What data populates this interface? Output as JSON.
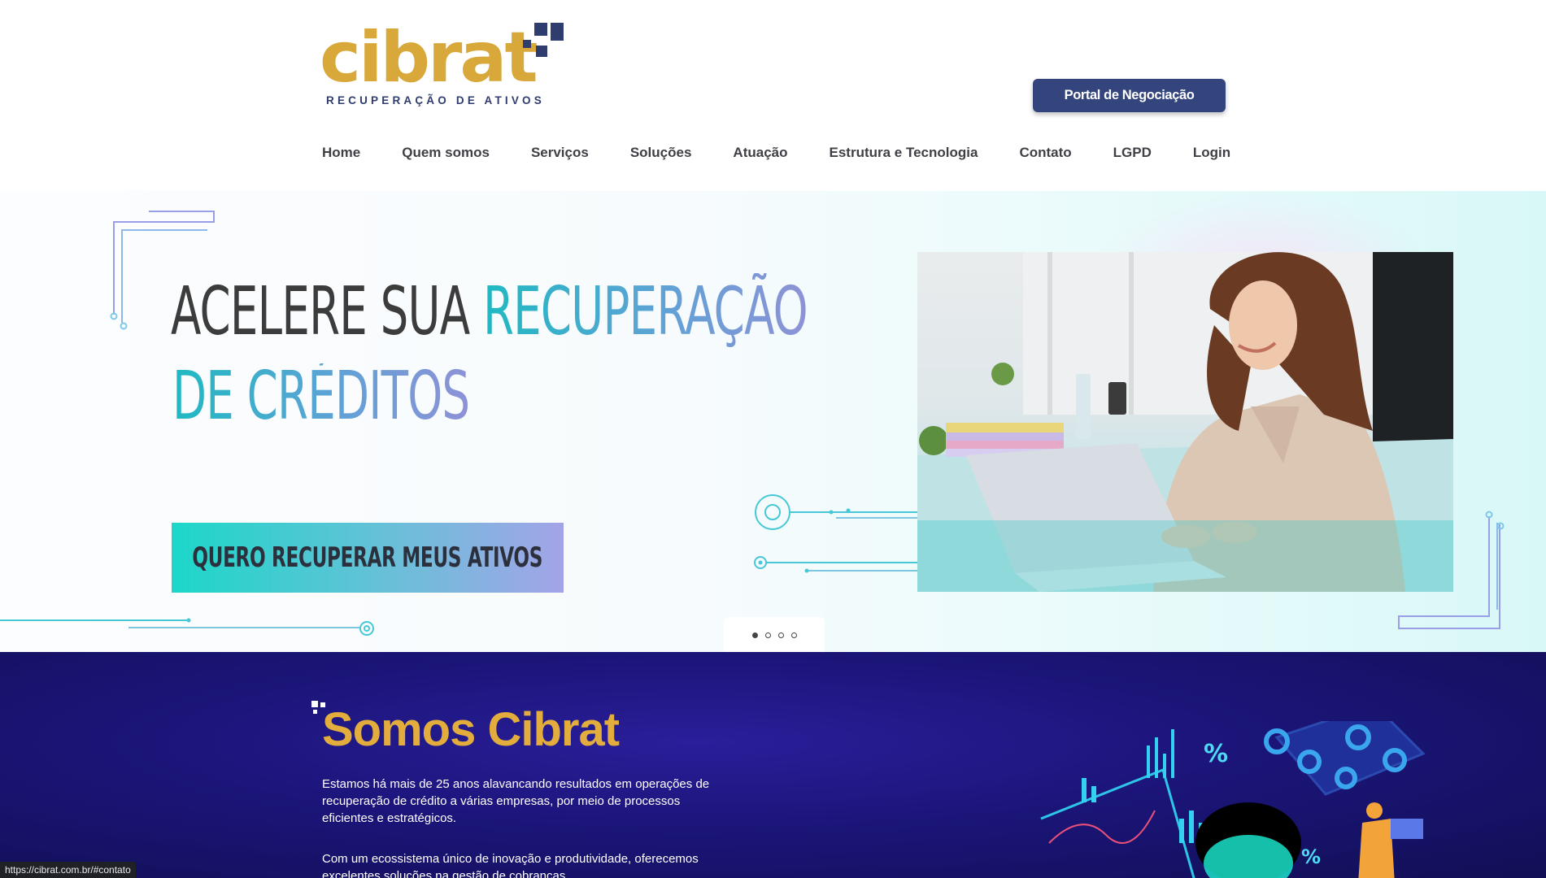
{
  "brand": {
    "logo_text": "cibrat",
    "tagline": "RECUPERAÇÃO DE ATIVOS",
    "primary_color": "#34447c",
    "accent_color": "#d8a83a"
  },
  "header": {
    "portal_button": "Portal de Negociação",
    "nav": [
      {
        "label": "Home"
      },
      {
        "label": "Quem somos"
      },
      {
        "label": "Serviços"
      },
      {
        "label": "Soluções"
      },
      {
        "label": "Atuação"
      },
      {
        "label": "Estrutura e Tecnologia"
      },
      {
        "label": "Contato"
      },
      {
        "label": "LGPD"
      },
      {
        "label": "Login"
      }
    ]
  },
  "hero": {
    "line1_dark": "ACELERE SUA ",
    "line1_color": "RECUPERAÇÃO",
    "line2_color": "DE CRÉDITOS",
    "cta": "QUERO RECUPERAR MEUS ATIVOS",
    "slides_total": 4,
    "slide_active": 1
  },
  "about": {
    "title": "Somos Cibrat",
    "paragraph1": "Estamos há mais de 25 anos alavancando resultados em operações de recuperação de crédito a várias empresas, por meio de processos eficientes e estratégicos.",
    "paragraph2": "Com um ecossistema único de inovação e produtividade, oferecemos excelentes soluções na gestão de cobranças."
  },
  "status_bar": {
    "url": "https://cibrat.com.br/#contato"
  }
}
